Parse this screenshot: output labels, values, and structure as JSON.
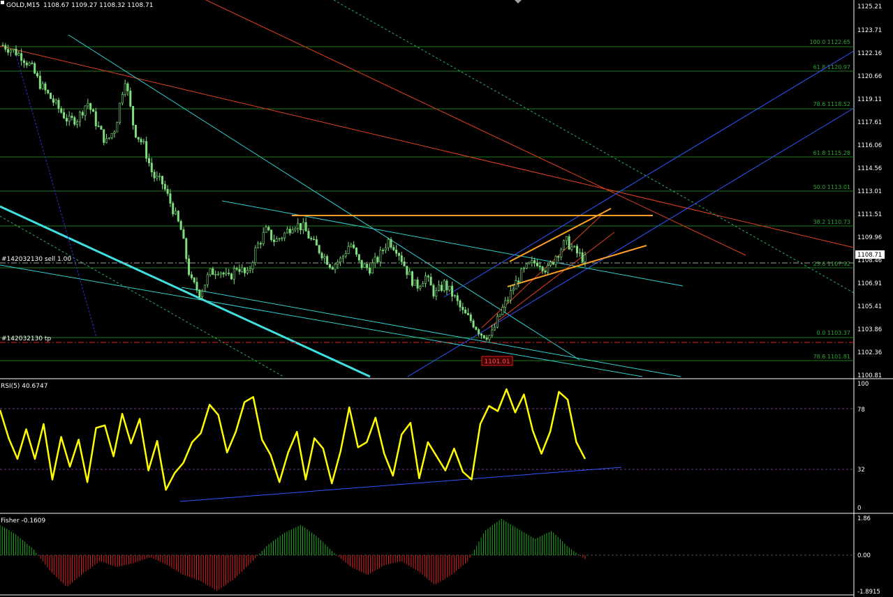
{
  "header": {
    "symbol": "GOLD,M15",
    "ohlc": "1108.67 1109.27 1108.32 1108.71"
  },
  "price_axis": {
    "ticks": [
      "1125.21",
      "1123.71",
      "1122.16",
      "1120.66",
      "1119.11",
      "1117.61",
      "1116.06",
      "1114.56",
      "1113.01",
      "1111.51",
      "1109.96",
      "1108.46",
      "1106.91",
      "1105.41",
      "1103.86",
      "1102.36",
      "1100.81"
    ],
    "current_price_label": "1108.71"
  },
  "fibonacci": [
    {
      "label": "100.0 1122.65"
    },
    {
      "label": "61.8 1120.97"
    },
    {
      "label": "78.6 1118.52"
    },
    {
      "label": "61.8 1115.28"
    },
    {
      "label": "50.0 1113.01"
    },
    {
      "label": "38.2 1110.73"
    },
    {
      "label": "23.6 1107.92"
    },
    {
      "label": "0.0 1103.37"
    },
    {
      "label": "78.6 1101.81"
    }
  ],
  "orders": {
    "sell_label": "#142032130 sell 1.00",
    "tp_label": "#142032130 tp"
  },
  "stop_box_label": "1101.01",
  "rsi": {
    "title": "RSI(5) 40.6747",
    "ticks": [
      "100",
      "78",
      "32",
      "0"
    ]
  },
  "fisher": {
    "title": "Fisher -0.1609",
    "ticks": [
      "1.86",
      "0.00",
      "-1.8915"
    ]
  },
  "colors": {
    "background": "#000000",
    "candle": "#7fe07f",
    "fib_line": "#1f7a1f",
    "channel_blue": "#3355ff",
    "trend_red": "#e04020",
    "cyan": "#30d0d0",
    "orange": "#ffa020",
    "rsi_line": "#ffff00",
    "fisher_up": "#20b020",
    "fisher_down": "#e02020"
  },
  "chart_data": [
    {
      "type": "candlestick",
      "title": "GOLD,M15",
      "ylim": [
        1100.81,
        1125.21
      ],
      "close_path": [
        1122.6,
        1122.3,
        1121.9,
        1121.2,
        1120.0,
        1119.2,
        1118.4,
        1117.6,
        1117.8,
        1118.9,
        1117.4,
        1116.2,
        1117.2,
        1120.5,
        1117.0,
        1116.0,
        1114.0,
        1113.5,
        1112.0,
        1110.4,
        1107.1,
        1106.3,
        1107.6,
        1107.9,
        1107.2,
        1108.1,
        1107.4,
        1109.3,
        1110.4,
        1109.7,
        1110.2,
        1110.9,
        1110.6,
        1109.6,
        1108.9,
        1108.1,
        1108.5,
        1109.6,
        1108.2,
        1107.9,
        1108.6,
        1109.8,
        1109.2,
        1107.8,
        1106.7,
        1107.4,
        1106.2,
        1106.9,
        1106.1,
        1105.0,
        1104.4,
        1103.6,
        1103.5,
        1105.0,
        1106.2,
        1107.4,
        1108.1,
        1108.4,
        1107.8,
        1108.9,
        1109.7,
        1109.0,
        1108.5
      ]
    },
    {
      "type": "line",
      "title": "RSI(5) 40.6747",
      "ylim": [
        0,
        100
      ],
      "values": [
        78,
        56,
        40,
        63,
        40,
        67,
        24,
        57,
        34,
        55,
        22,
        64,
        66,
        42,
        75,
        52,
        71,
        31,
        54,
        16,
        29,
        37,
        53,
        60,
        82,
        74,
        45,
        61,
        84,
        88,
        55,
        43,
        22,
        45,
        61,
        24,
        56,
        48,
        21,
        46,
        80,
        49,
        53,
        72,
        44,
        27,
        59,
        68,
        25,
        53,
        42,
        31,
        48,
        30,
        24,
        67,
        81,
        77,
        94,
        76,
        90,
        62,
        44,
        61,
        92,
        86,
        53,
        40
      ]
    },
    {
      "type": "bar",
      "title": "Fisher -0.1609",
      "ylim": [
        -1.8915,
        1.86
      ],
      "values": [
        1.5,
        1.0,
        0.3,
        -0.8,
        -1.6,
        -0.9,
        -0.3,
        -0.6,
        -0.4,
        -0.1,
        -0.5,
        -1.0,
        -1.3,
        -1.8,
        -1.2,
        -0.4,
        0.5,
        1.1,
        1.5,
        0.9,
        0.1,
        -0.6,
        -1.0,
        -0.5,
        -0.3,
        -0.8,
        -1.5,
        -1.0,
        -0.3,
        1.2,
        1.8,
        1.3,
        0.8,
        1.2,
        0.4,
        -0.2
      ]
    }
  ]
}
